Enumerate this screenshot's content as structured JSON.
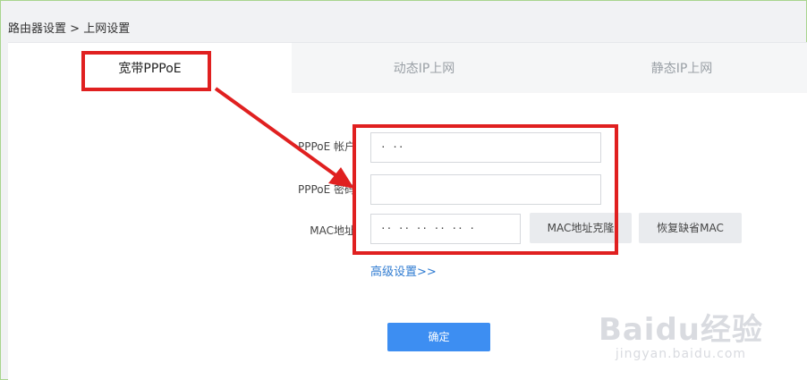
{
  "breadcrumb": {
    "root": "路由器设置",
    "separator": ">",
    "current": "上网设置"
  },
  "tabs": [
    {
      "label": "宽带PPPoE",
      "active": true
    },
    {
      "label": "动态IP上网",
      "active": false
    },
    {
      "label": "静态IP上网",
      "active": false
    }
  ],
  "form": {
    "account_label": "PPPoE 帐户",
    "account_value": "   ·   ··",
    "password_label": "PPPoE 密码",
    "password_value": "",
    "mac_label": "MAC地址",
    "mac_value": "·· ·· ·· ·· ··  ·",
    "mac_clone_button": "MAC地址克隆",
    "mac_restore_button": "恢复缺省MAC",
    "advanced_link": "高级设置>>",
    "confirm_button": "确定"
  },
  "watermark": {
    "logo": "Baidu经验",
    "url": "jingyan.baidu.com"
  },
  "colors": {
    "highlight": "#e02020",
    "primary": "#3d8ef2",
    "link": "#2f7bd1"
  }
}
